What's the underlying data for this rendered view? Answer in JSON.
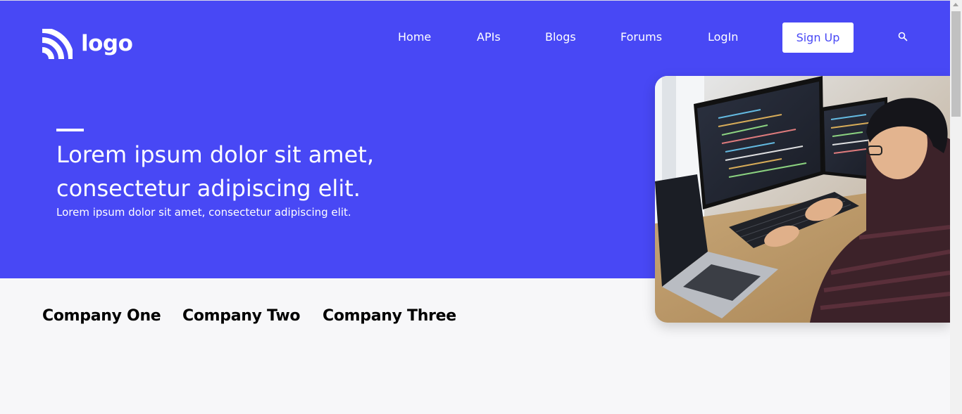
{
  "logo": {
    "text": "logo",
    "icon": "wifi-arcs-icon"
  },
  "nav": {
    "items": [
      {
        "label": "Home"
      },
      {
        "label": "APIs"
      },
      {
        "label": "Blogs"
      },
      {
        "label": "Forums"
      },
      {
        "label": "LogIn"
      }
    ],
    "signup_label": "Sign Up",
    "search_icon": "search-icon"
  },
  "hero": {
    "headline_line1": "Lorem ipsum dolor sit amet,",
    "headline_line2": "consectetur adipiscing elit.",
    "subline": "Lorem ipsum dolor sit amet, consectetur adipiscing elit.",
    "image_subject": "developer-at-computer-photo"
  },
  "companies": [
    {
      "name": "Company One"
    },
    {
      "name": "Company Two"
    },
    {
      "name": "Company Three"
    }
  ],
  "colors": {
    "brand": "#4848f5",
    "background": "#f7f7f9",
    "text_light": "#ffffff",
    "text_dark": "#000000"
  }
}
